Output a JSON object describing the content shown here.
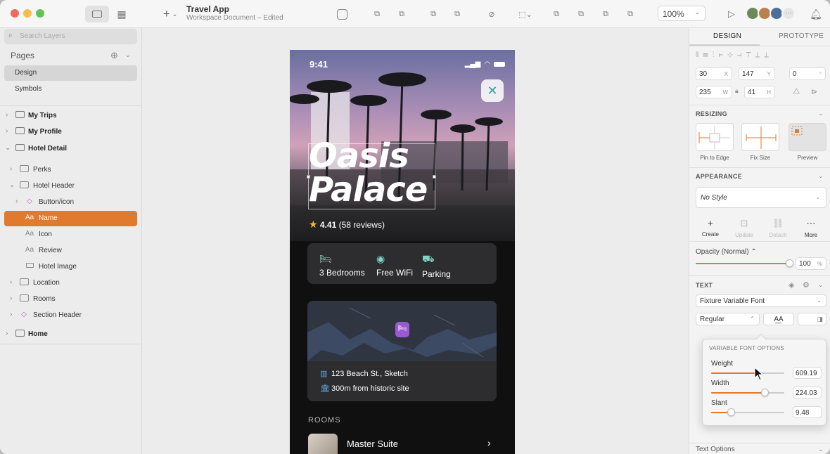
{
  "toolbar": {
    "doc_title": "Travel App",
    "doc_subtitle": "Workspace Document – Edited",
    "zoom": "100%"
  },
  "sidebar": {
    "search_placeholder": "Search Layers",
    "pages_header": "Pages",
    "pages": [
      "Design",
      "Symbols"
    ],
    "layers": [
      {
        "label": "My Trips"
      },
      {
        "label": "My Profile"
      },
      {
        "label": "Hotel Detail"
      },
      {
        "label": "Perks"
      },
      {
        "label": "Hotel Header"
      },
      {
        "label": "Button/icon"
      },
      {
        "label": "Name"
      },
      {
        "label": "Icon"
      },
      {
        "label": "Review"
      },
      {
        "label": "Hotel Image"
      },
      {
        "label": "Location"
      },
      {
        "label": "Rooms"
      },
      {
        "label": "Section Header"
      },
      {
        "label": "Home"
      }
    ],
    "text_layer_prefix": "Aa"
  },
  "artboard": {
    "time": "9:41",
    "title_line1": "Oasis",
    "title_line2": "Palace",
    "rating": "4.41",
    "reviews": "(58 reviews)",
    "amenities": [
      "3 Bedrooms",
      "Free WiFi",
      "Parking"
    ],
    "address": "123 Beach St., Sketch",
    "distance": "300m from historic site",
    "rooms_header": "ROOMS",
    "room_name": "Master Suite"
  },
  "inspector": {
    "tab_design": "DESIGN",
    "tab_prototype": "PROTOTYPE",
    "x": "30",
    "x_suf": "X",
    "y": "147",
    "y_suf": "Y",
    "rot": "0",
    "rot_suf": "°",
    "w": "235",
    "w_suf": "W",
    "h": "41",
    "h_suf": "H",
    "resizing": "RESIZING",
    "pin_to_edge": "Pin to Edge",
    "fix_size": "Fix Size",
    "preview": "Preview",
    "appearance": "APPEARANCE",
    "style": "No Style",
    "create": "Create",
    "update": "Update",
    "detach": "Detach",
    "more": "More",
    "opacity_label": "Opacity (Normal)",
    "opacity_value": "100",
    "opacity_suf": "%",
    "opacity_level": 1.0,
    "text_header": "TEXT",
    "font": "Fixture Variable Font",
    "weight_style": "Regular",
    "text_options": "Text Options"
  },
  "popover": {
    "title": "VARIABLE FONT OPTIONS",
    "axes": [
      {
        "label": "Weight",
        "value": "609.19",
        "level": 0.6
      },
      {
        "label": "Width",
        "value": "224.03",
        "level": 0.74
      },
      {
        "label": "Slant",
        "value": "9.48",
        "level": 0.28
      }
    ]
  },
  "colors": {
    "accent": "#e07a2f",
    "teal": "#7fd6c8",
    "pin": "#9b59d0"
  }
}
